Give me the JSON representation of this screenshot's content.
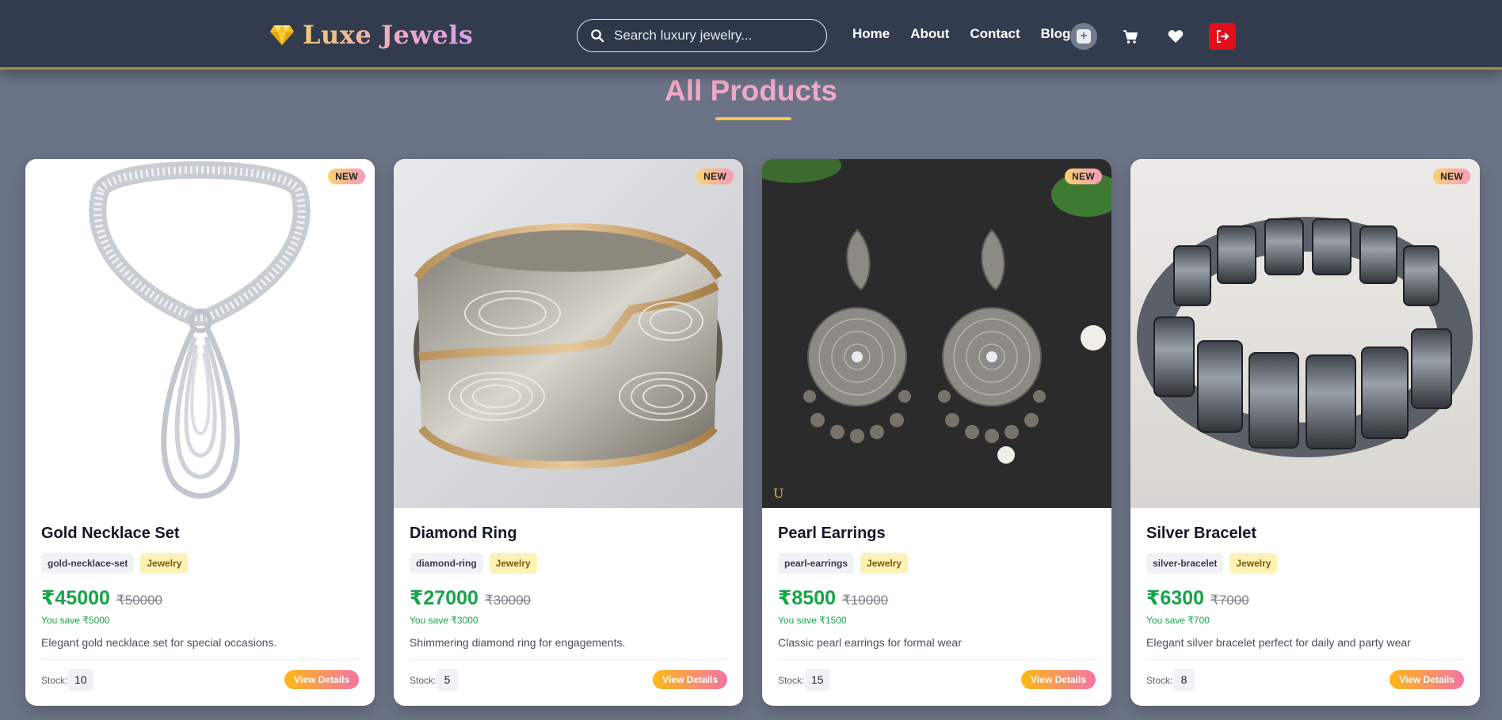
{
  "header": {
    "brand": "Luxe Jewels",
    "search_placeholder": "Search luxury jewelry...",
    "nav": [
      "Home",
      "About",
      "Contact",
      "Blog"
    ]
  },
  "page": {
    "title": "All Products"
  },
  "products": [
    {
      "badge": "NEW",
      "name": "Gold Necklace Set",
      "slug": "gold-necklace-set",
      "category": "Jewelry",
      "price": "₹45000",
      "old_price": "₹50000",
      "saving": "You save ₹5000",
      "description": "Elegant gold necklace set for special occasions.",
      "stock_label": "Stock:",
      "stock": "10",
      "button": "View Details"
    },
    {
      "badge": "NEW",
      "name": "Diamond Ring",
      "slug": "diamond-ring",
      "category": "Jewelry",
      "price": "₹27000",
      "old_price": "₹30000",
      "saving": "You save ₹3000",
      "description": "Shimmering diamond ring for engagements.",
      "stock_label": "Stock:",
      "stock": "5",
      "button": "View Details"
    },
    {
      "badge": "NEW",
      "name": "Pearl Earrings",
      "slug": "pearl-earrings",
      "category": "Jewelry",
      "price": "₹8500",
      "old_price": "₹10000",
      "saving": "You save ₹1500",
      "description": "Classic pearl earrings for formal wear",
      "stock_label": "Stock:",
      "stock": "15",
      "button": "View Details"
    },
    {
      "badge": "NEW",
      "name": "Silver Bracelet",
      "slug": "silver-bracelet",
      "category": "Jewelry",
      "price": "₹6300",
      "old_price": "₹7000",
      "saving": "You save ₹700",
      "description": "Elegant silver bracelet perfect for daily and party wear",
      "stock_label": "Stock:",
      "stock": "8",
      "button": "View Details"
    }
  ],
  "icons": {
    "logo": "diamond-icon",
    "search": "search-icon",
    "add": "plus-square-icon",
    "cart": "cart-icon",
    "wishlist": "heart-icon",
    "logout": "logout-icon"
  },
  "colors": {
    "nav_bg": "#333c4f",
    "page_bg": "#6b7386",
    "title": "#f1a8c9",
    "price": "#17a34a",
    "logout": "#e30f1a"
  }
}
